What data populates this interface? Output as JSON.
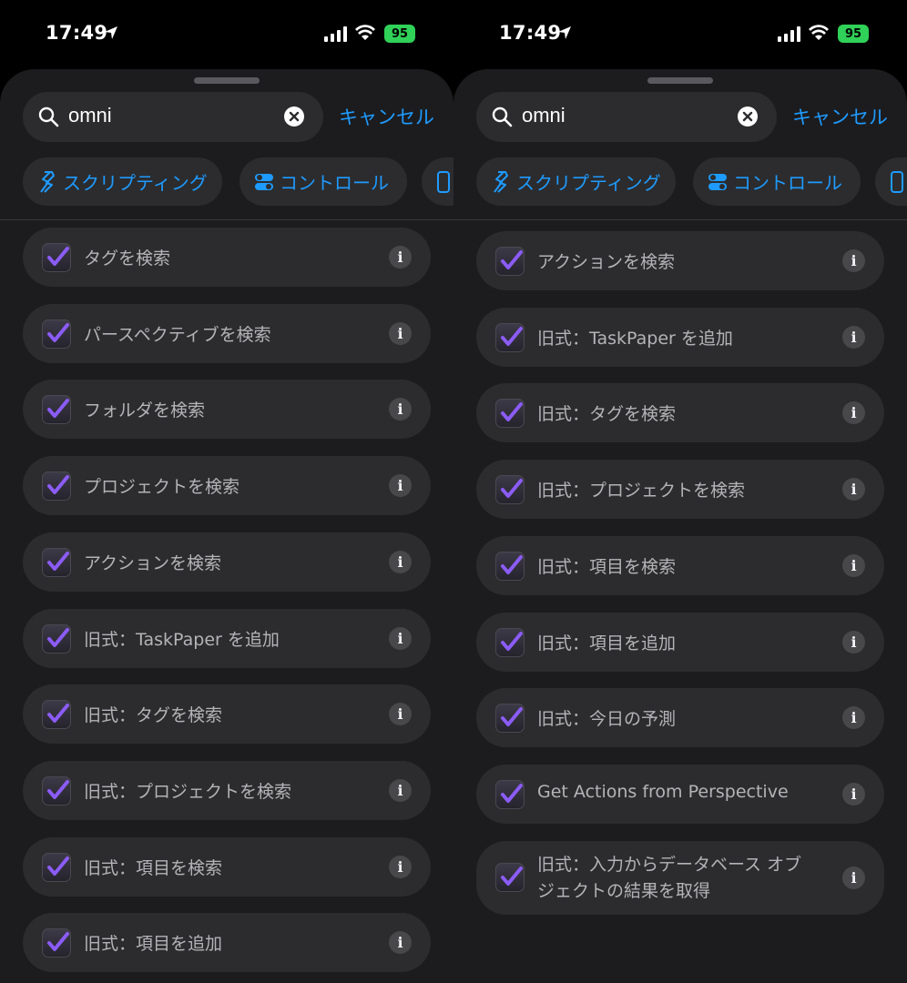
{
  "status": {
    "time": "17:49",
    "battery": "95"
  },
  "search": {
    "value": "omni",
    "cancel_label": "キャンセル"
  },
  "chips": [
    {
      "label": "スクリプティング",
      "icon": "scripting-icon"
    },
    {
      "label": "コントロール",
      "icon": "toggle-icon"
    },
    {
      "label": "",
      "icon": "device-icon"
    }
  ],
  "left_list": [
    "タグを検索",
    "パースペクティブを検索",
    "フォルダを検索",
    "プロジェクトを検索",
    "アクションを検索",
    "旧式：TaskPaper を追加",
    "旧式：タグを検索",
    "旧式：プロジェクトを検索",
    "旧式：項目を検索",
    "旧式：項目を追加"
  ],
  "right_list": [
    "アクションを検索",
    "旧式：TaskPaper を追加",
    "旧式：タグを検索",
    "旧式：プロジェクトを検索",
    "旧式：項目を検索",
    "旧式：項目を追加",
    "旧式：今日の予測",
    "Get Actions from Perspective",
    "旧式：入力からデータベース オブジェクトの結果を取得"
  ],
  "info_glyph": "i",
  "colors": {
    "accent": "#1e9bff",
    "check": "#8b5cf6",
    "battery": "#30d158"
  }
}
